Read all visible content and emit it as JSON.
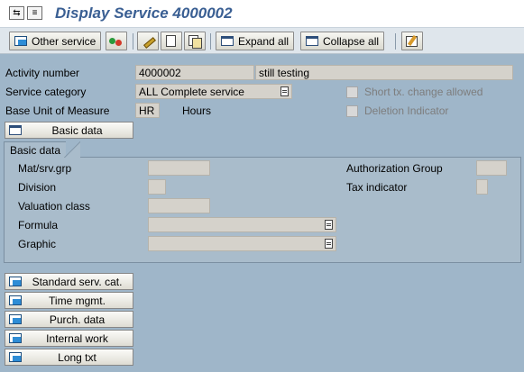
{
  "window": {
    "title": "Display Service 4000002"
  },
  "title_icons": [
    "display-toggle-icon",
    "menu-icon"
  ],
  "toolbar": {
    "other_service": "Other service",
    "expand_all": "Expand all",
    "collapse_all": "Collapse all"
  },
  "header": {
    "activity_number_label": "Activity number",
    "activity_number_value": "4000002",
    "activity_description": "still testing",
    "service_category_label": "Service category",
    "service_category_value": "ALL Complete service",
    "base_uom_label": "Base Unit of Measure",
    "base_uom_value": "HR",
    "base_uom_text": "Hours",
    "short_text_change_label": "Short tx. change allowed",
    "deletion_indicator_label": "Deletion Indicator"
  },
  "basic_data": {
    "button_label": "Basic data",
    "group_title": "Basic data",
    "mat_srv_grp_label": "Mat/srv.grp",
    "division_label": "Division",
    "valuation_class_label": "Valuation class",
    "formula_label": "Formula",
    "graphic_label": "Graphic",
    "authorization_group_label": "Authorization Group",
    "tax_indicator_label": "Tax indicator"
  },
  "sections": {
    "standard_serv_cat": "Standard serv. cat.",
    "time_mgmt": "Time mgmt.",
    "purch_data": "Purch. data",
    "internal_work": "Internal work",
    "long_txt": "Long txt"
  },
  "colors": {
    "background": "#9fb6c9",
    "title": "#3a5f93",
    "field": "#d5d2cb"
  }
}
